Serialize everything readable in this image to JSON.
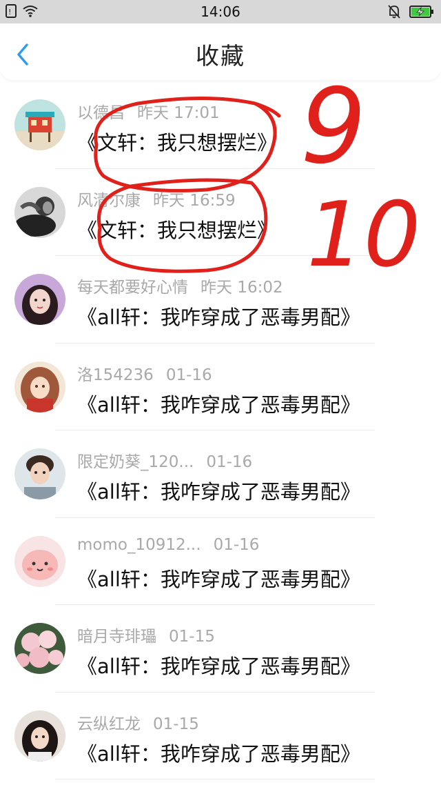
{
  "status_bar": {
    "time": "14:06"
  },
  "header": {
    "title": "收藏"
  },
  "items": [
    {
      "user": "以德昌",
      "date": "昨天 17:01",
      "book": "《文轩：我只想摆烂》"
    },
    {
      "user": "风清尔康",
      "date": "昨天 16:59",
      "book": "《文轩：我只想摆烂》"
    },
    {
      "user": "每天都要好心情",
      "date": "昨天 16:02",
      "book": "《all轩：我咋穿成了恶毒男配》"
    },
    {
      "user": "洛154236",
      "date": "01-16",
      "book": "《all轩：我咋穿成了恶毒男配》"
    },
    {
      "user": "限定奶葵_120...",
      "date": "01-16",
      "book": "《all轩：我咋穿成了恶毒男配》"
    },
    {
      "user": "momo_10912...",
      "date": "01-16",
      "book": "《all轩：我咋穿成了恶毒男配》"
    },
    {
      "user": "暗月寺琲瓃",
      "date": "01-15",
      "book": "《all轩：我咋穿成了恶毒男配》"
    },
    {
      "user": "云纵红龙",
      "date": "01-15",
      "book": "《all轩：我咋穿成了恶毒男配》"
    }
  ],
  "annotations": [
    "9",
    "10"
  ]
}
